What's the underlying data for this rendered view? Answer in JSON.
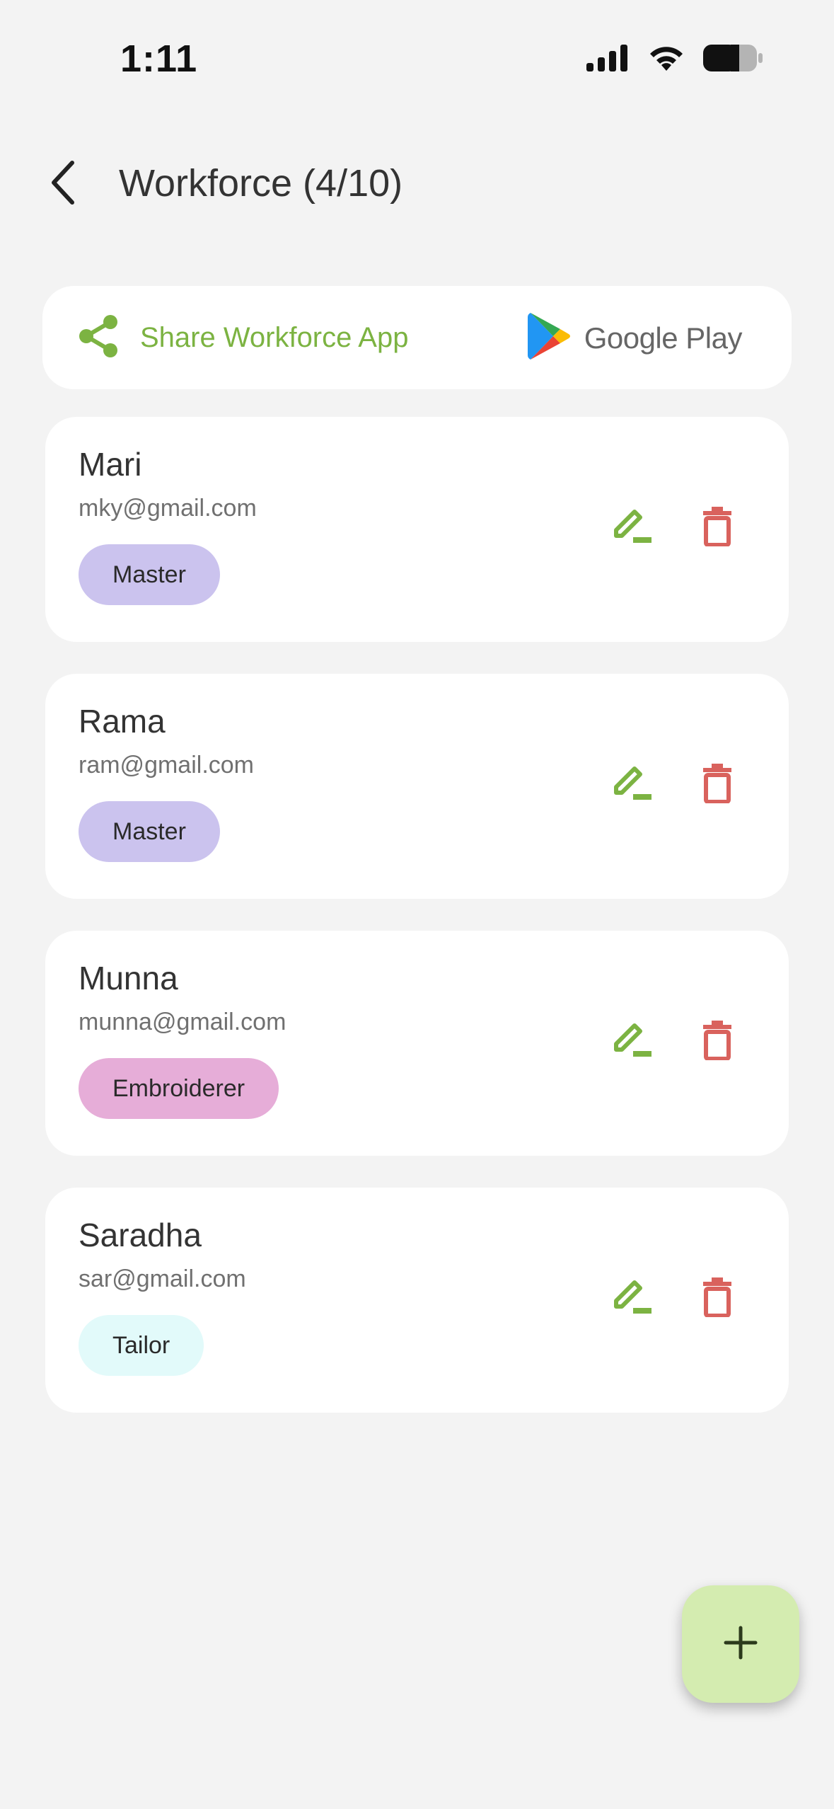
{
  "status_bar": {
    "time": "1:11"
  },
  "header": {
    "title": "Workforce (4/10)"
  },
  "share_card": {
    "label": "Share Workforce App",
    "store_label": "Google Play"
  },
  "colors": {
    "accent_green": "#7cb342",
    "delete_red": "#d9625d",
    "badge_master": "#cbc3ee",
    "badge_embroiderer": "#e6add8",
    "badge_tailor": "#e2fafa",
    "fab_bg": "#d4ecb0"
  },
  "workers": [
    {
      "name": "Mari",
      "email": "mky@gmail.com",
      "role": "Master"
    },
    {
      "name": "Rama",
      "email": "ram@gmail.com",
      "role": "Master"
    },
    {
      "name": "Munna",
      "email": "munna@gmail.com",
      "role": "Embroiderer"
    },
    {
      "name": "Saradha",
      "email": "sar@gmail.com",
      "role": "Tailor"
    }
  ],
  "icons": {
    "back": "chevron-left-icon",
    "share": "share-icon",
    "store": "google-play-icon",
    "edit": "edit-icon",
    "delete": "trash-icon",
    "add": "plus-icon"
  }
}
